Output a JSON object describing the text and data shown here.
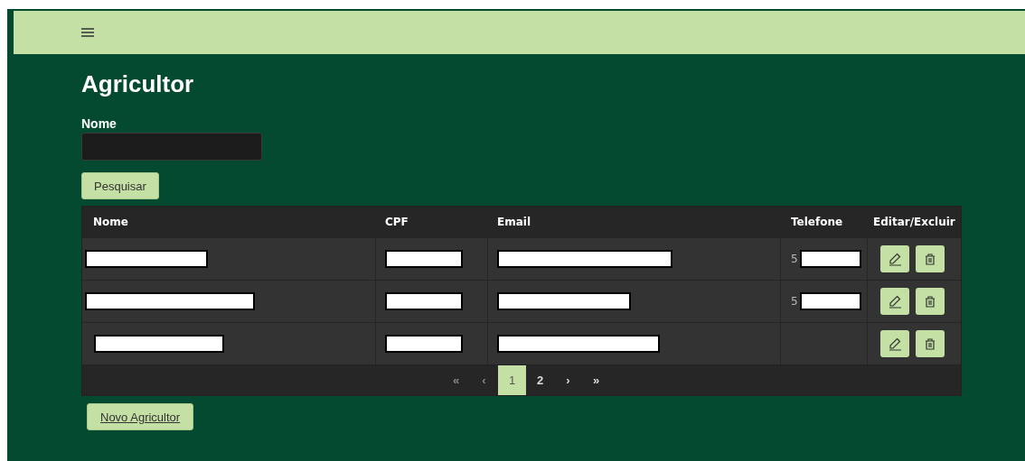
{
  "page_title": "Agricultor",
  "filter": {
    "label": "Nome",
    "button": "Pesquisar"
  },
  "table": {
    "columns": [
      "Nome",
      "CPF",
      "Email",
      "Telefone",
      "Editar/Excluir"
    ],
    "rows": [
      {
        "cells": [
          {
            "redacted": true
          },
          {
            "redacted": true
          },
          {
            "redacted": true
          },
          {
            "text": "5",
            "redacted": true
          }
        ]
      },
      {
        "cells": [
          {
            "redacted": true
          },
          {
            "redacted": true
          },
          {
            "redacted": true
          },
          {
            "text": "5",
            "redacted": true
          }
        ]
      },
      {
        "cells": [
          {
            "redacted": true
          },
          {
            "redacted": true
          },
          {
            "redacted": true
          },
          {
            "redacted": false
          }
        ]
      }
    ]
  },
  "pagination": [
    {
      "label": "«",
      "selected": false,
      "disabled": true
    },
    {
      "label": "‹",
      "selected": false,
      "disabled": true
    },
    {
      "label": "1",
      "selected": true,
      "disabled": false
    },
    {
      "label": "2",
      "selected": false,
      "disabled": false
    },
    {
      "label": "›",
      "selected": false,
      "disabled": false
    },
    {
      "label": "»",
      "selected": false,
      "disabled": false
    }
  ],
  "new_button": "Novo Agricultor"
}
